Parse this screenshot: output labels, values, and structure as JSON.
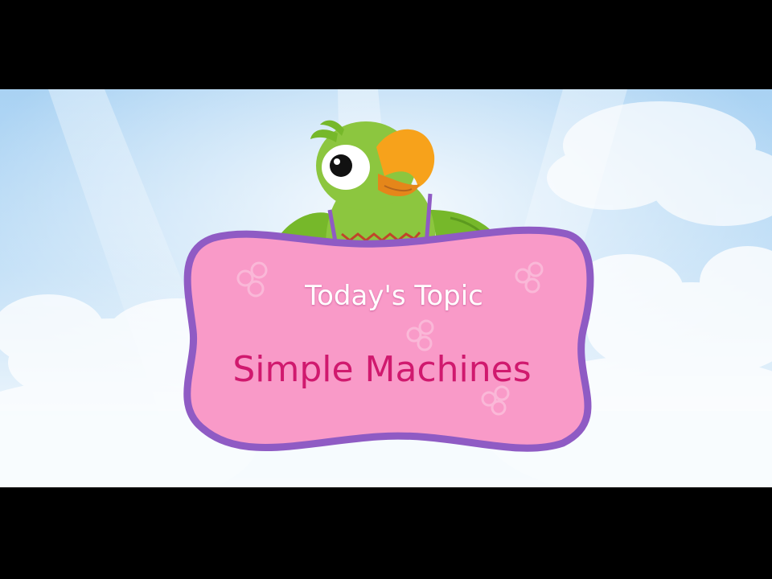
{
  "sign": {
    "subtitle": "Today's Topic",
    "topic": "Simple Machines"
  },
  "colors": {
    "sky_top": "#a9d2f3",
    "sky_bottom": "#f4f9fd",
    "sign_fill": "#f99ac8",
    "sign_border": "#8f5bc4",
    "topic_text": "#d0196e",
    "parrot_green": "#8cc63f",
    "beak": "#f7a21b"
  },
  "icons": [
    "parrot-mascot",
    "cloud",
    "flower-pattern"
  ]
}
